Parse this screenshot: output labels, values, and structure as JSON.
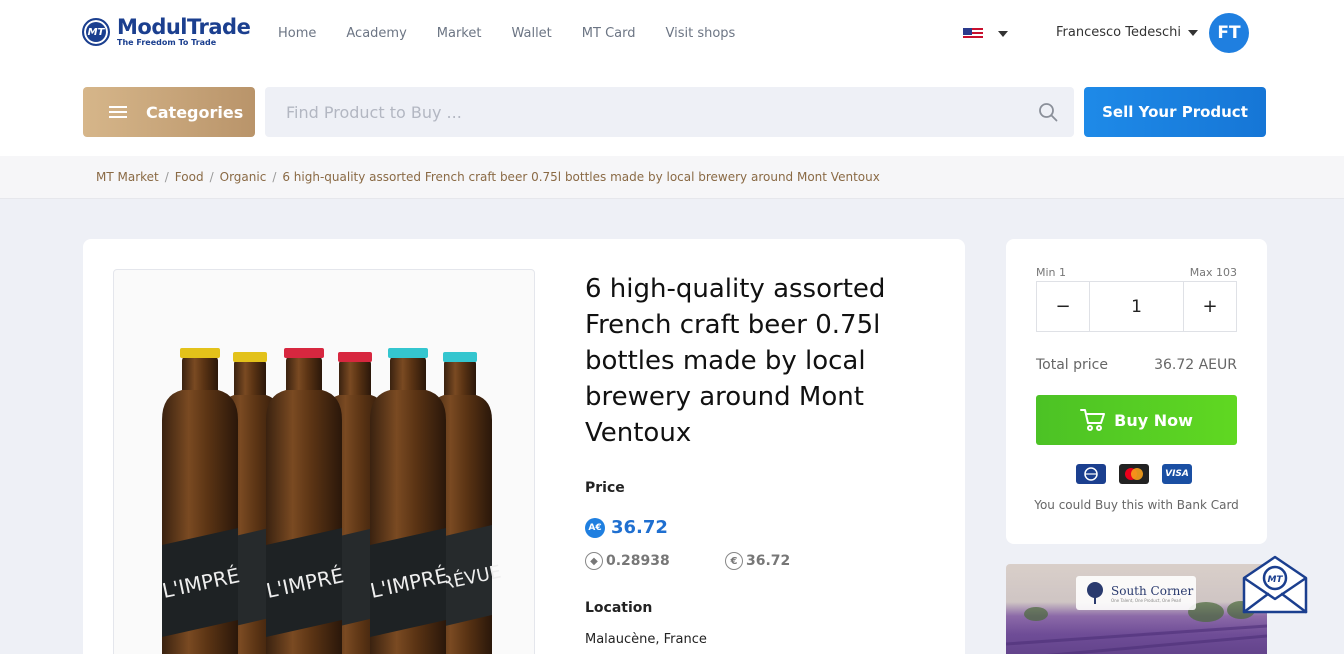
{
  "header": {
    "logo": {
      "name": "ModulTrade",
      "tagline": "The Freedom To Trade",
      "mark": "MT"
    },
    "nav": [
      "Home",
      "Academy",
      "Market",
      "Wallet",
      "MT Card",
      "Visit shops"
    ],
    "language_flag": "us-flag-icon",
    "user": {
      "name": "Francesco Tedeschi",
      "initials": "FT"
    }
  },
  "toolbar": {
    "categories_label": "Categories",
    "search_placeholder": "Find Product to Buy ...",
    "sell_label": "Sell Your Product"
  },
  "breadcrumb": [
    "MT Market",
    "Food",
    "Organic",
    "6 high-quality assorted French craft beer 0.75l bottles made by local brewery around Mont Ventoux"
  ],
  "product": {
    "title": "6 high-quality assorted French craft beer 0.75l bottles made by local brewery around Mont Ventoux",
    "price_label": "Price",
    "currency_badge": "A€",
    "price": "36.72",
    "eth_price": "0.28938",
    "eur_price": "36.72",
    "location_label": "Location",
    "location": "Malaucène, France",
    "image_alt_brand": "L'IMPRÉVUE"
  },
  "purchase": {
    "min_label": "Min 1",
    "max_label": "Max 103",
    "quantity": "1",
    "decrement": "−",
    "increment": "+",
    "total_label": "Total price",
    "total_value": "36.72 AEUR",
    "buy_label": "Buy Now",
    "payment_cards": [
      "mt-card-icon",
      "mastercard-icon",
      "visa-icon"
    ],
    "visa_text": "VISA",
    "bank_note": "You could Buy this with Bank Card"
  },
  "banner": {
    "name": "South Corner",
    "tagline": "One Talent, One Product, One Pearl"
  },
  "colors": {
    "brand_blue": "#1b3f8f",
    "accent_blue": "#1f7fe0",
    "gold": "#c9a678",
    "green": "#52c923"
  }
}
